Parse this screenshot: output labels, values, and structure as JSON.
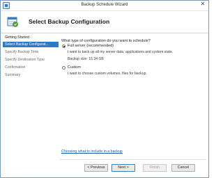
{
  "window": {
    "title": "Backup Schedule Wizard",
    "close_glyph": "✕"
  },
  "header": {
    "title": "Select Backup Configuration",
    "icon": "backup-calendar-icon"
  },
  "nav": {
    "items": [
      {
        "label": "Getting Started",
        "state": "completed"
      },
      {
        "label": "Select Backup Configurat...",
        "state": "active"
      },
      {
        "label": "Specify Backup Time",
        "state": "pending"
      },
      {
        "label": "Specify Destination Type",
        "state": "pending"
      },
      {
        "label": "Confirmation",
        "state": "pending"
      },
      {
        "label": "Summary",
        "state": "pending"
      }
    ]
  },
  "content": {
    "question": "What type of configuration do you want to schedule?",
    "options": [
      {
        "label": "Full server (recommended)",
        "selected": true,
        "description": "I want to back up all my server data, applications and system state.",
        "detail": "Backup size: 15.34 GB"
      },
      {
        "label": "Custom",
        "selected": false,
        "description": "I want to choose custom volumes, files for backup.",
        "detail": ""
      }
    ],
    "help_link": "Choosing what to include in a backup"
  },
  "buttons": {
    "previous": "< Previous",
    "next": "Next >",
    "finish": "Finish",
    "cancel": "Cancel"
  },
  "colors": {
    "accent": "#2b79c7",
    "link": "#1c5dab"
  }
}
